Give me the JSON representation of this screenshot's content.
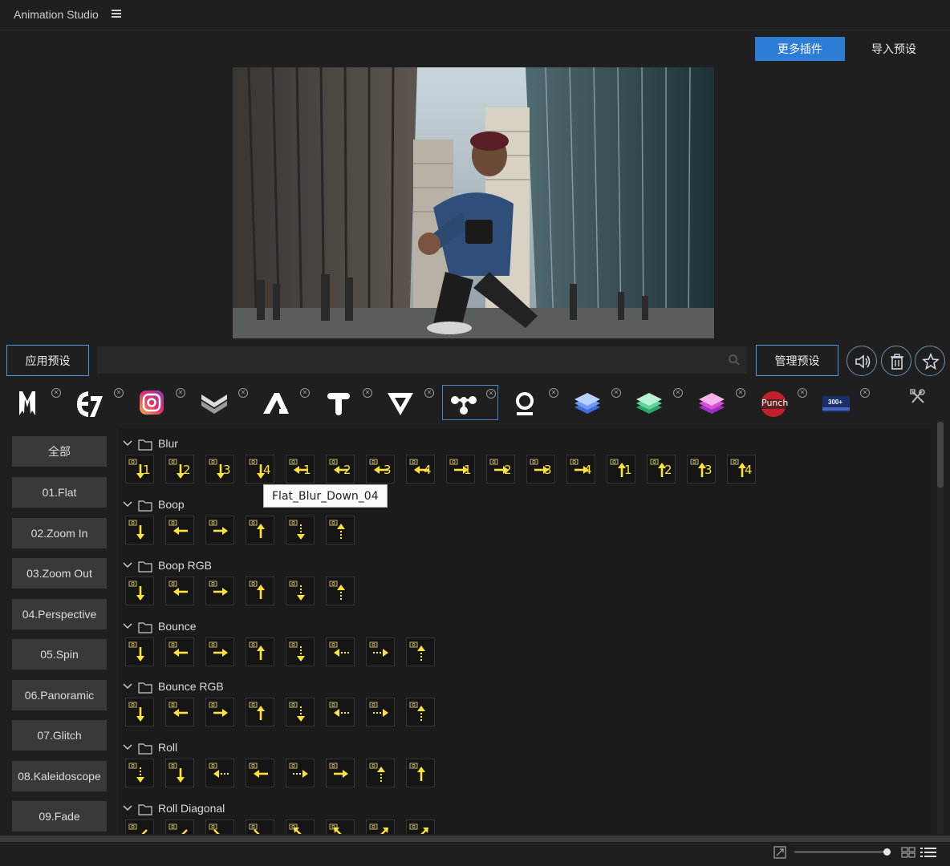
{
  "app": {
    "title": "Animation Studio"
  },
  "header": {
    "more_plugins_label": "更多插件",
    "import_presets_label": "导入预设"
  },
  "toolbar": {
    "apply_label": "应用预设",
    "manage_label": "管理预设",
    "search_placeholder": "",
    "icons": [
      "sound-icon",
      "trash-icon",
      "star-icon",
      "search-icon"
    ]
  },
  "plugins": [
    {
      "name": "M",
      "logo": "m-logo"
    },
    {
      "name": "E7",
      "logo": "e7-logo"
    },
    {
      "name": "Instagram",
      "logo": "instagram-logo"
    },
    {
      "name": "Chevron",
      "logo": "chevron-logo"
    },
    {
      "name": "A",
      "logo": "a-logo"
    },
    {
      "name": "T",
      "logo": "t-logo"
    },
    {
      "name": "V",
      "logo": "v-logo"
    },
    {
      "name": "Nodes",
      "logo": "nodes-logo",
      "selected": true
    },
    {
      "name": "O",
      "logo": "o-logo"
    },
    {
      "name": "Blue",
      "logo": "blue-layers-logo"
    },
    {
      "name": "Green",
      "logo": "green-layers-logo"
    },
    {
      "name": "Pink",
      "logo": "pink-layers-logo"
    },
    {
      "name": "Punch",
      "logo": "punch-logo",
      "label": "Punch"
    },
    {
      "name": "300+",
      "logo": "transitions-logo",
      "label": "300+"
    }
  ],
  "categories": [
    "全部",
    "01.Flat",
    "02.Zoom In",
    "03.Zoom Out",
    "04.Perspective",
    "05.Spin",
    "06.Panoramic",
    "07.Glitch",
    "08.Kaleidoscope",
    "09.Fade"
  ],
  "groups": [
    {
      "name": "Blur",
      "tiles": [
        "1",
        "2",
        "3",
        "4",
        "1",
        "2",
        "3",
        "4",
        "1",
        "2",
        "3",
        "4",
        "1",
        "2",
        "3",
        "4"
      ],
      "arrows": [
        "down",
        "down",
        "down",
        "down",
        "left",
        "left",
        "left",
        "left",
        "right",
        "right",
        "right",
        "right",
        "up",
        "up",
        "up",
        "up"
      ]
    },
    {
      "name": "Boop",
      "tiles": [
        "",
        "",
        "",
        "",
        "",
        ""
      ],
      "arrows": [
        "down",
        "left",
        "right",
        "up",
        "ddown",
        "dup"
      ]
    },
    {
      "name": "Boop RGB",
      "tiles": [
        "",
        "",
        "",
        "",
        "",
        ""
      ],
      "arrows": [
        "down",
        "left",
        "right",
        "up",
        "ddown",
        "dup"
      ]
    },
    {
      "name": "Bounce",
      "tiles": [
        "",
        "",
        "",
        "",
        "",
        "",
        "",
        ""
      ],
      "arrows": [
        "down",
        "left",
        "right",
        "up",
        "ddown",
        "dleft",
        "dright",
        "dup"
      ]
    },
    {
      "name": "Bounce RGB",
      "tiles": [
        "",
        "",
        "",
        "",
        "",
        "",
        "",
        ""
      ],
      "arrows": [
        "down",
        "left",
        "right",
        "up",
        "ddown",
        "dleft",
        "dright",
        "dup"
      ]
    },
    {
      "name": "Roll",
      "tiles": [
        "",
        "",
        "",
        "",
        "",
        "",
        "",
        ""
      ],
      "arrows": [
        "ddown",
        "down",
        "dleft",
        "left",
        "dright",
        "right",
        "dup",
        "up"
      ]
    },
    {
      "name": "Roll Diagonal",
      "tiles": [
        "",
        "",
        "",
        "",
        "",
        "",
        "",
        ""
      ],
      "arrows": [
        "dl",
        "dl",
        "dr",
        "dr",
        "ul",
        "ul",
        "ur",
        "ur"
      ]
    }
  ],
  "tooltip": {
    "text": "Flat_Blur_Down_04"
  },
  "footer": {
    "zoom_value": 0.96
  }
}
